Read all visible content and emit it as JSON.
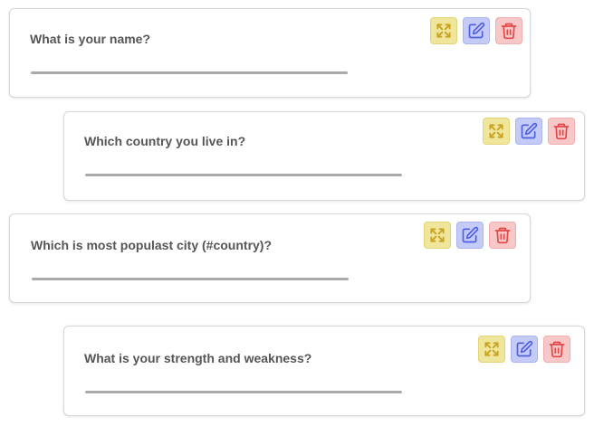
{
  "questions": [
    {
      "text": "What is your name?"
    },
    {
      "text": "Which country you live in?"
    },
    {
      "text": "Which is most populast city (#country)?"
    },
    {
      "text": "What is your strength and weakness?"
    }
  ],
  "actions": {
    "expand_icon": "expand-icon",
    "edit_icon": "edit-icon",
    "delete_icon": "trash-icon"
  },
  "colors": {
    "expand": "#c9a321",
    "edit": "#4f5fe0",
    "delete": "#e04848"
  }
}
